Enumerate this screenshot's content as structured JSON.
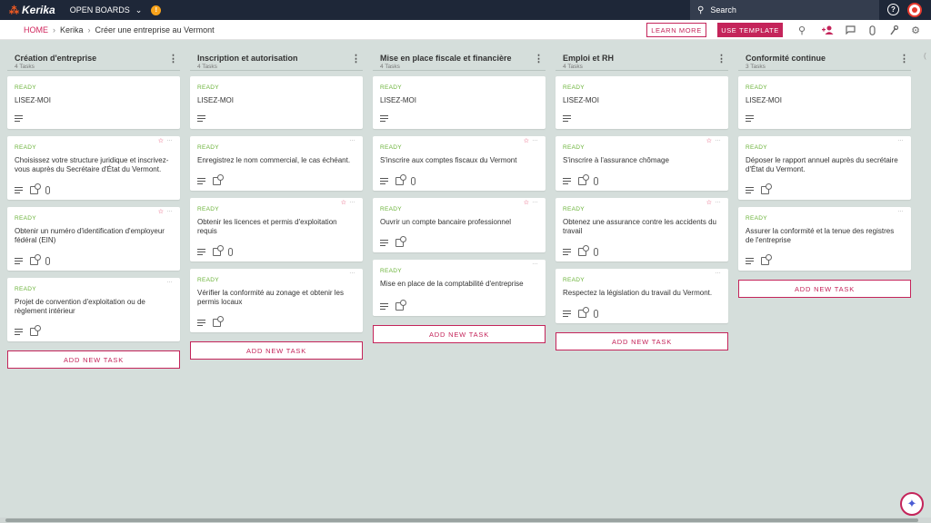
{
  "app": {
    "logo_text": "Kerika",
    "open_boards_label": "OPEN BOARDS",
    "notification_count": "!",
    "search_placeholder": "Search"
  },
  "breadcrumb": {
    "home": "HOME",
    "account": "Kerika",
    "board": "Créer une entreprise au Vermont"
  },
  "toolbar": {
    "learn_more": "LEARN MORE",
    "use_template": "USE TEMPLATE"
  },
  "icons": {
    "logo": "kerika-logo-icon",
    "search": "search-icon",
    "help": "help-icon",
    "add_person": "add-person-icon",
    "chat": "chat-icon",
    "attachment": "paperclip-icon",
    "tools": "wrench-icon",
    "settings": "gear-icon"
  },
  "colors": {
    "topbar": "#1e2738",
    "accent": "#c4245a",
    "status_ready": "#6bb33a",
    "board_bg": "#d5dedb"
  },
  "add_task_label": "ADD NEW TASK",
  "columns": [
    {
      "title": "Création d'entreprise",
      "count": "4 Tasks",
      "cards": [
        {
          "status": "READY",
          "title": "LISEZ-MOI",
          "star": false
        },
        {
          "status": "READY",
          "title": "Choisissez votre structure juridique et inscrivez-vous auprès du Secrétaire d'État du Vermont.",
          "star": true
        },
        {
          "status": "READY",
          "title": "Obtenir un numéro d'identification d'employeur fédéral (EIN)",
          "star": true
        },
        {
          "status": "READY",
          "title": "Projet de convention d'exploitation ou de règlement intérieur",
          "star": false
        }
      ]
    },
    {
      "title": "Inscription et autorisation",
      "count": "4 Tasks",
      "cards": [
        {
          "status": "READY",
          "title": "LISEZ-MOI",
          "star": false
        },
        {
          "status": "READY",
          "title": "Enregistrez le nom commercial, le cas échéant.",
          "star": false
        },
        {
          "status": "READY",
          "title": "Obtenir les licences et permis d'exploitation requis",
          "star": true
        },
        {
          "status": "READY",
          "title": "Vérifier la conformité au zonage et obtenir les permis locaux",
          "star": false
        }
      ]
    },
    {
      "title": "Mise en place fiscale et financière",
      "count": "4 Tasks",
      "cards": [
        {
          "status": "READY",
          "title": "LISEZ-MOI",
          "star": false
        },
        {
          "status": "READY",
          "title": "S'inscrire aux comptes fiscaux du Vermont",
          "star": true
        },
        {
          "status": "READY",
          "title": "Ouvrir un compte bancaire professionnel",
          "star": true
        },
        {
          "status": "READY",
          "title": "Mise en place de la comptabilité d'entreprise",
          "star": false
        }
      ]
    },
    {
      "title": "Emploi et RH",
      "count": "4 Tasks",
      "cards": [
        {
          "status": "READY",
          "title": "LISEZ-MOI",
          "star": false
        },
        {
          "status": "READY",
          "title": "S'inscrire à l'assurance chômage",
          "star": true
        },
        {
          "status": "READY",
          "title": "Obtenez une assurance contre les accidents du travail",
          "star": true
        },
        {
          "status": "READY",
          "title": "Respectez la législation du travail du Vermont.",
          "star": false
        }
      ]
    },
    {
      "title": "Conformité continue",
      "count": "3 Tasks",
      "cards": [
        {
          "status": "READY",
          "title": "LISEZ-MOI",
          "star": false
        },
        {
          "status": "READY",
          "title": "Déposer le rapport annuel auprès du secrétaire d'État du Vermont.",
          "star": false
        },
        {
          "status": "READY",
          "title": "Assurer la conformité et la tenue des registres de l'entreprise",
          "star": false
        }
      ]
    }
  ]
}
